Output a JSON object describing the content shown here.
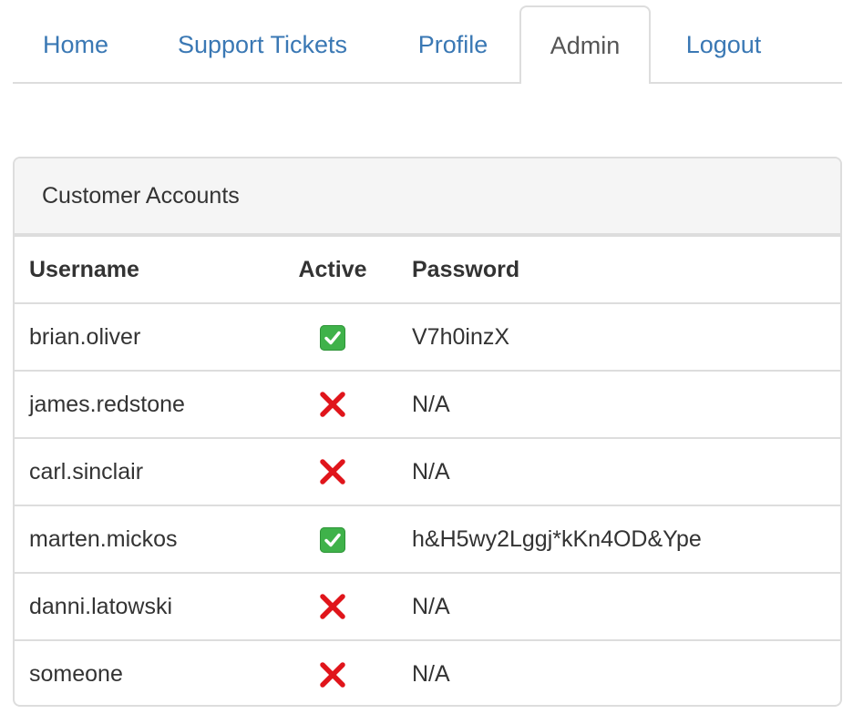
{
  "nav": {
    "tabs": [
      {
        "label": "Home",
        "active": false
      },
      {
        "label": "Support Tickets",
        "active": false
      },
      {
        "label": "Profile",
        "active": false
      },
      {
        "label": "Admin",
        "active": true
      },
      {
        "label": "Logout",
        "active": false
      }
    ]
  },
  "panel": {
    "title": "Customer Accounts",
    "columns": [
      "Username",
      "Active",
      "Password"
    ],
    "rows": [
      {
        "username": "brian.oliver",
        "active": true,
        "active_icon": "check-mark-icon",
        "password": "V7h0inzX"
      },
      {
        "username": "james.redstone",
        "active": false,
        "active_icon": "cross-mark-icon",
        "password": "N/A"
      },
      {
        "username": "carl.sinclair",
        "active": false,
        "active_icon": "cross-mark-icon",
        "password": "N/A"
      },
      {
        "username": "marten.mickos",
        "active": true,
        "active_icon": "check-mark-icon",
        "password": "h&H5wy2Lggj*kKn4OD&Ype"
      },
      {
        "username": "danni.latowski",
        "active": false,
        "active_icon": "cross-mark-icon",
        "password": "N/A"
      },
      {
        "username": "someone",
        "active": false,
        "active_icon": "cross-mark-icon",
        "password": "N/A"
      }
    ]
  },
  "colors": {
    "link": "#3a78b4",
    "border": "#dddddd",
    "check": "#3fb24a",
    "cross": "#e0151b"
  }
}
